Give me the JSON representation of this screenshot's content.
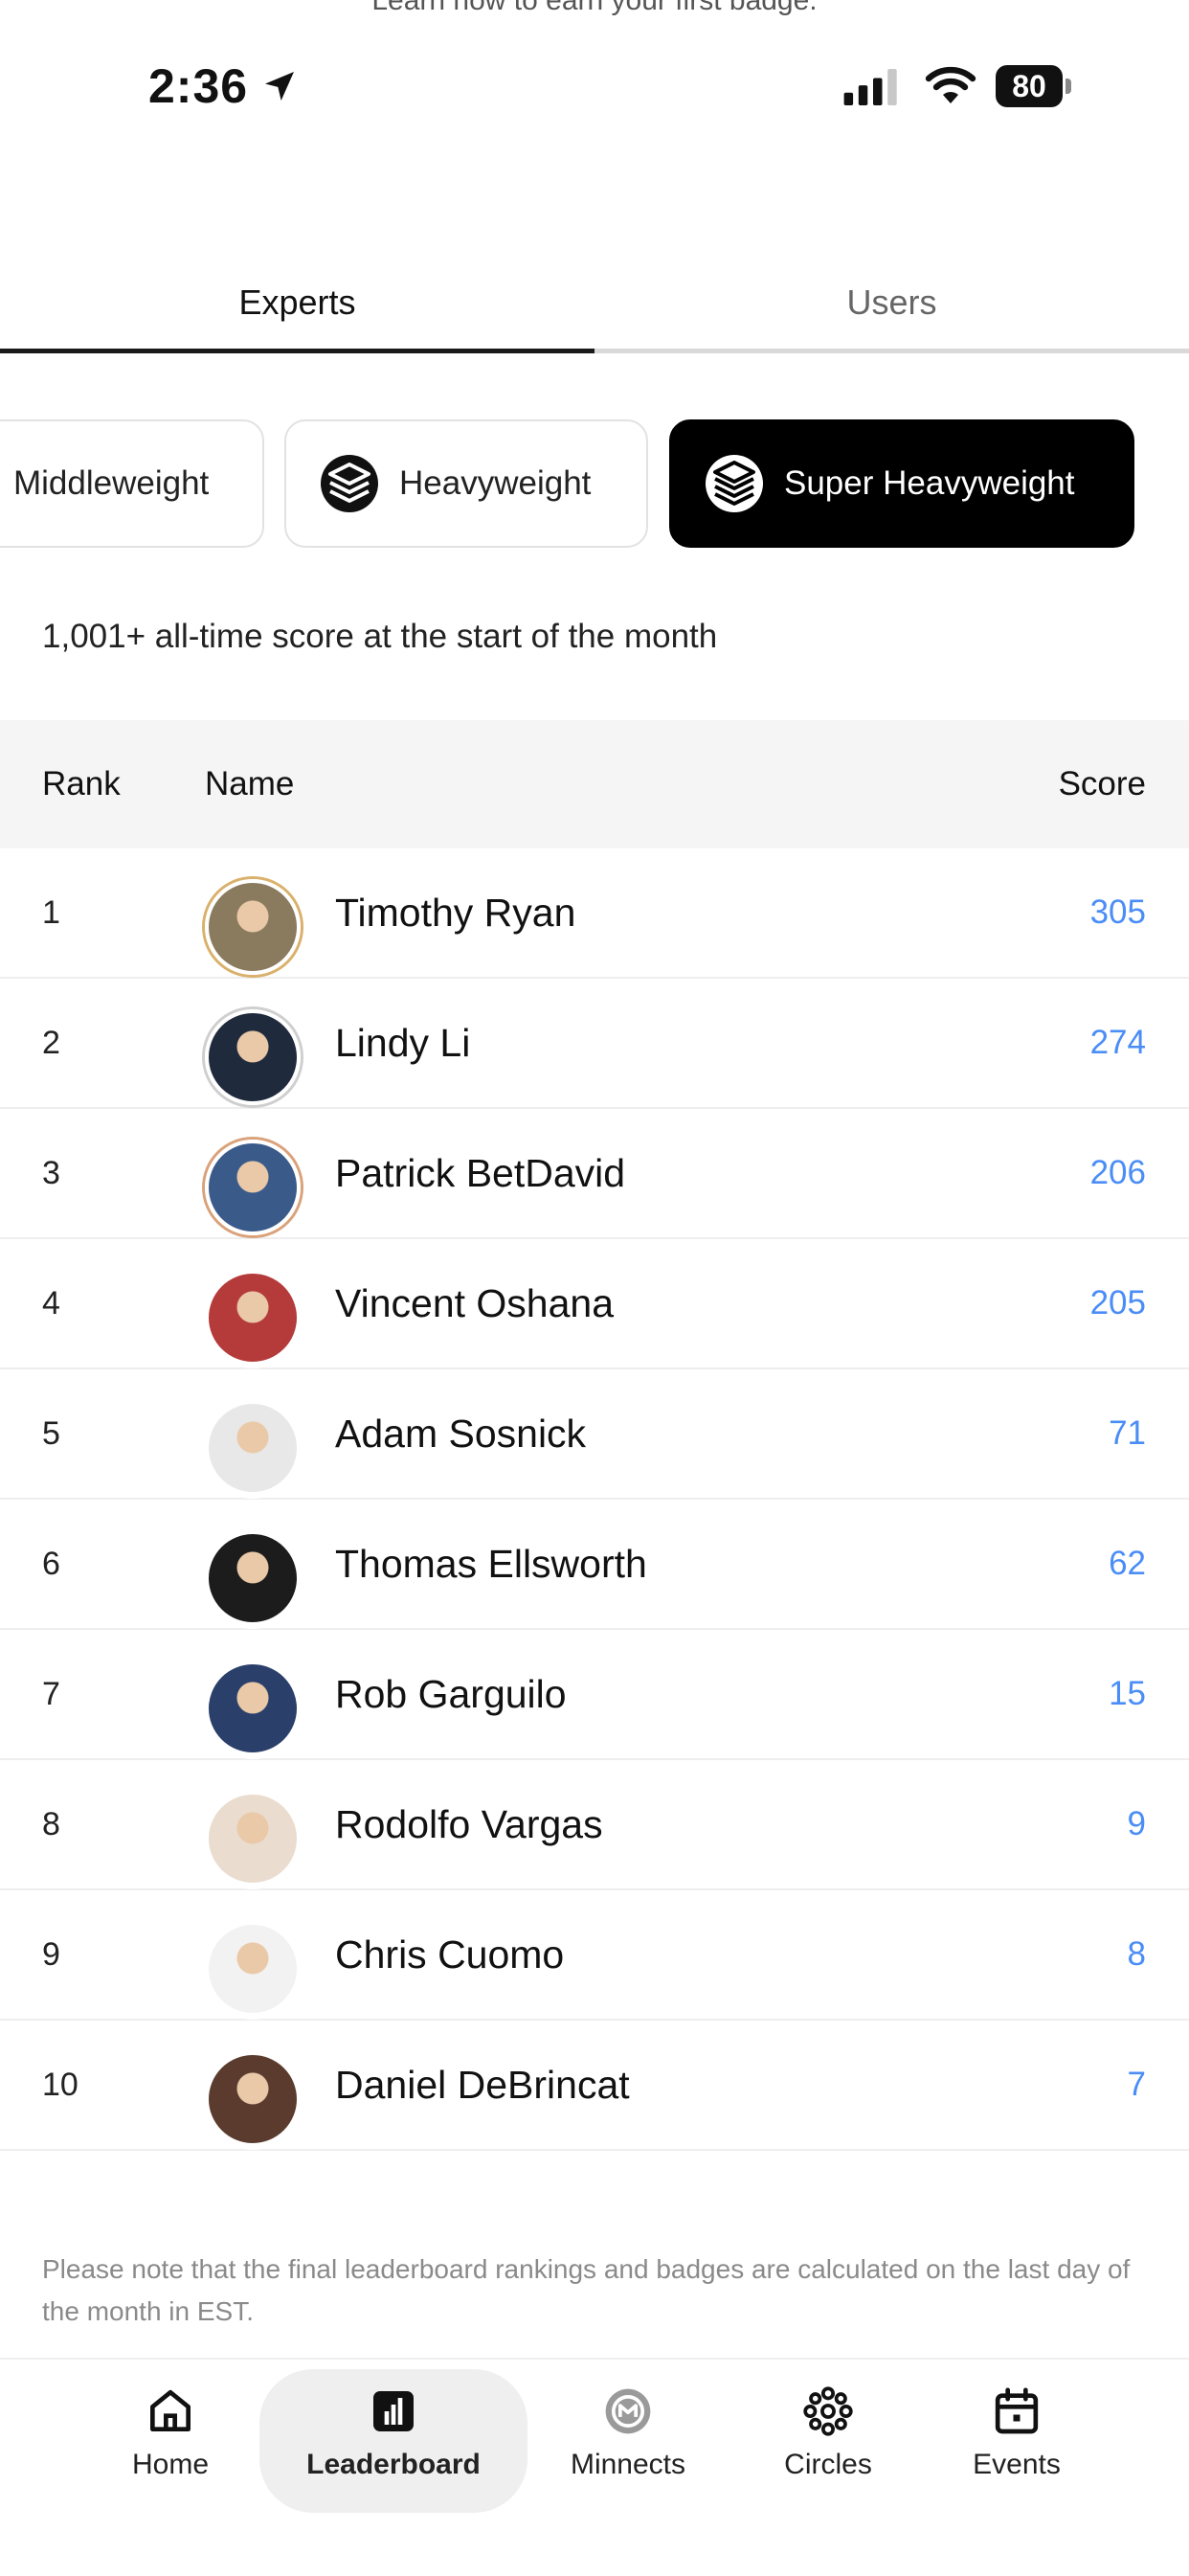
{
  "top_note": "Learn how to earn your first badge.",
  "status_bar": {
    "time": "2:36",
    "battery": "80"
  },
  "tabs": [
    {
      "label": "Experts",
      "active": true
    },
    {
      "label": "Users",
      "active": false
    }
  ],
  "weight_classes": [
    {
      "label": "Middleweight",
      "selected": false
    },
    {
      "label": "Heavyweight",
      "selected": false,
      "icon": "layers-icon"
    },
    {
      "label": "Super Heavyweight",
      "selected": true,
      "icon": "layers-icon"
    }
  ],
  "description": "1,001+ all-time score at the start of the month",
  "table": {
    "headers": {
      "rank": "Rank",
      "name": "Name",
      "score": "Score"
    },
    "rows": [
      {
        "rank": "1",
        "name": "Timothy Ryan",
        "score": "305",
        "ring": "#d9b16c",
        "bg": "#8a7a5e"
      },
      {
        "rank": "2",
        "name": "Lindy Li",
        "score": "274",
        "ring": "#cfcfcf",
        "bg": "#1f2a3c"
      },
      {
        "rank": "3",
        "name": "Patrick BetDavid",
        "score": "206",
        "ring": "#d9a27a",
        "bg": "#3a5a8a"
      },
      {
        "rank": "4",
        "name": "Vincent Oshana",
        "score": "205",
        "ring": "#ffffff",
        "bg": "#b53a3a"
      },
      {
        "rank": "5",
        "name": "Adam  Sosnick",
        "score": "71",
        "ring": "#ffffff",
        "bg": "#e8e8e8"
      },
      {
        "rank": "6",
        "name": "Thomas Ellsworth",
        "score": "62",
        "ring": "#ffffff",
        "bg": "#1c1c1c"
      },
      {
        "rank": "7",
        "name": "Rob Garguilo",
        "score": "15",
        "ring": "#ffffff",
        "bg": "#2a3f6a"
      },
      {
        "rank": "8",
        "name": "Rodolfo Vargas",
        "score": "9",
        "ring": "#ffffff",
        "bg": "#eadccf"
      },
      {
        "rank": "9",
        "name": "Chris Cuomo",
        "score": "8",
        "ring": "#ffffff",
        "bg": "#f2f2f2"
      },
      {
        "rank": "10",
        "name": "Daniel DeBrincat",
        "score": "7",
        "ring": "#ffffff",
        "bg": "#5a3b2e"
      }
    ]
  },
  "footnote": "Please note that the final leaderboard rankings and badges are calculated on the last day of the month in EST.",
  "bottom_nav": [
    {
      "label": "Home",
      "icon": "home-icon"
    },
    {
      "label": "Leaderboard",
      "icon": "leaderboard-icon",
      "active": true
    },
    {
      "label": "Minnects",
      "icon": "minnects-icon"
    },
    {
      "label": "Circles",
      "icon": "circles-icon"
    },
    {
      "label": "Events",
      "icon": "calendar-icon"
    }
  ],
  "colors": {
    "score": "#4a8df7",
    "active_chip": "#000000",
    "header_bg": "#f5f5f5"
  }
}
